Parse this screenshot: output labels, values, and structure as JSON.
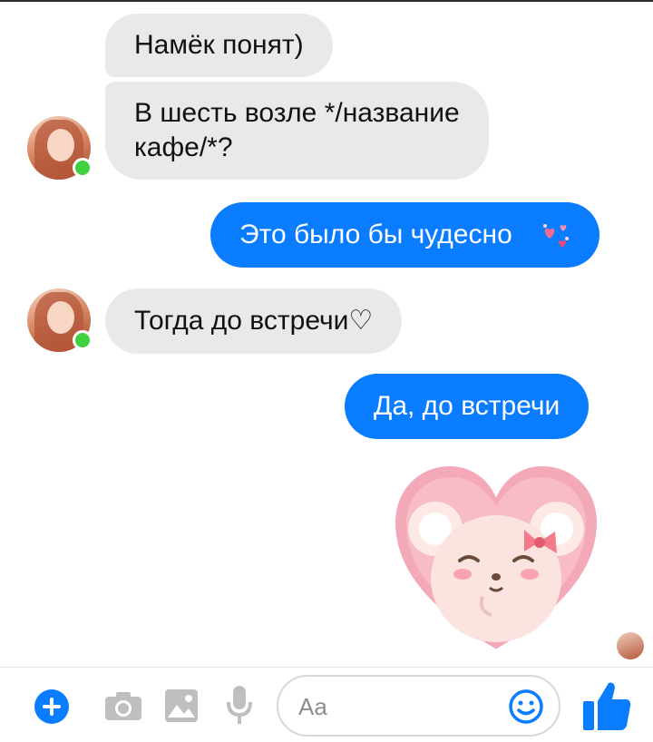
{
  "messages": [
    {
      "from": "them",
      "text": "Намёк понят)"
    },
    {
      "from": "them",
      "line1": "В шесть возле */название",
      "line2": "кафе/*?"
    },
    {
      "from": "me",
      "text": "Это было бы чудесно",
      "emoji": "sparkling-hearts-icon"
    },
    {
      "from": "them",
      "text": "Тогда до встречи♡"
    },
    {
      "from": "me",
      "text": "Да, до встречи"
    }
  ],
  "sticker": {
    "name": "heart-bear-sticker"
  },
  "composer": {
    "placeholder": "Aa",
    "icons": [
      "plus-icon",
      "camera-icon",
      "image-icon",
      "microphone-icon",
      "smiley-icon",
      "thumbs-up-icon"
    ]
  },
  "colors": {
    "outgoing_bubble": "#0a7cff",
    "incoming_bubble": "#e9e9eb",
    "accent": "#0a7cff",
    "online_dot": "#3fd13f",
    "icon_gray": "#bfbfbf"
  }
}
